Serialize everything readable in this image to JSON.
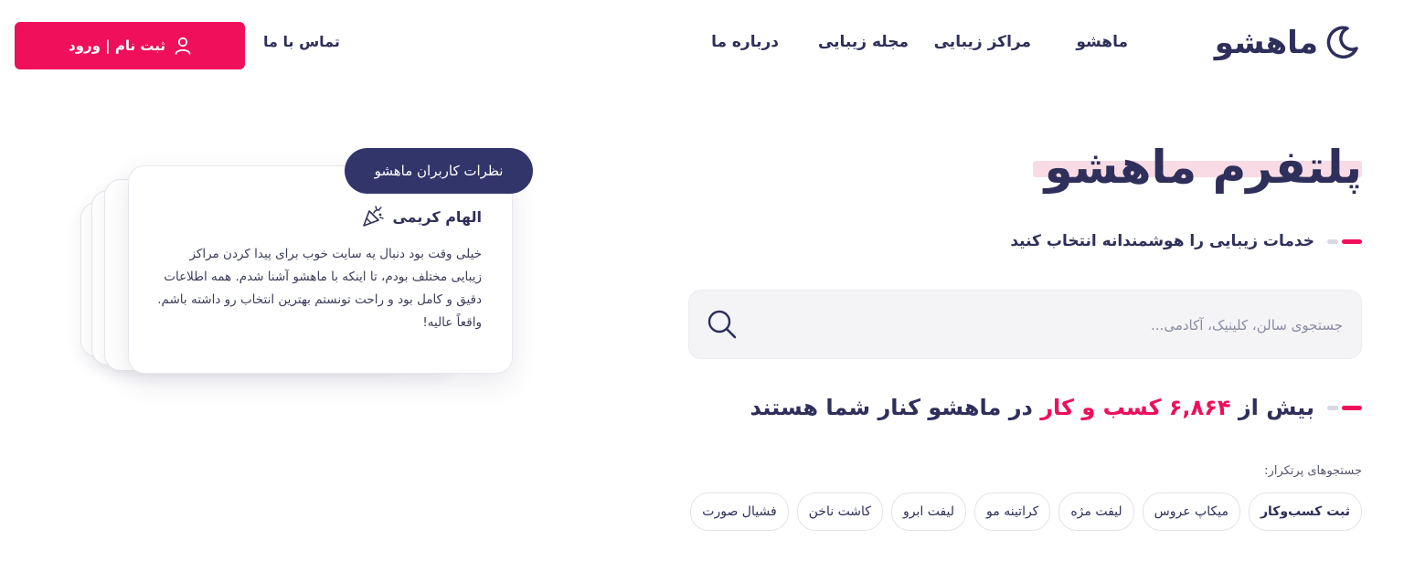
{
  "header": {
    "logo_text": "ماهشو",
    "nav": [
      "ماهشو",
      "مراکز زیبایی",
      "مجله زیبایی",
      "درباره ما"
    ],
    "contact": "تماس با ما",
    "login_label": "ثبت نام | ورود"
  },
  "hero": {
    "title": "پلتفرم ماهشو",
    "subtitle": "خدمات زیبایی را هوشمندانه انتخاب کنید"
  },
  "search": {
    "placeholder": "جستجوی سالن، کلینیک، آکادمی..."
  },
  "stats": {
    "prefix": "بیش از",
    "count": "۶,۸۶۴",
    "highlight": "کسب و کار",
    "suffix": "در ماهشو کنار شما هستند"
  },
  "frequent": {
    "label": "جستجوهای پرتکرار:",
    "chips": [
      "ثبت کسب‌وکار",
      "میکاپ عروس",
      "لیفت مژه",
      "کراتینه مو",
      "لیفت ابرو",
      "کاشت ناخن",
      "فشیال صورت"
    ]
  },
  "testimonial": {
    "badge": "نظرات کاربران ماهشو",
    "name": "الهام کریمی",
    "text": "خیلی وقت بود دنبال یه سایت خوب برای پیدا کردن مراکز زیبایی مختلف بودم، تا اینکه با ماهشو آشنا شدم. همه اطلاعات دقیق و کامل بود و راحت تونستم بهترین انتخاب رو داشته باشم. واقعاً عالیه!"
  },
  "colors": {
    "primary": "#ef0f5a",
    "navy": "#2e2f5a",
    "badge": "#32356a"
  }
}
